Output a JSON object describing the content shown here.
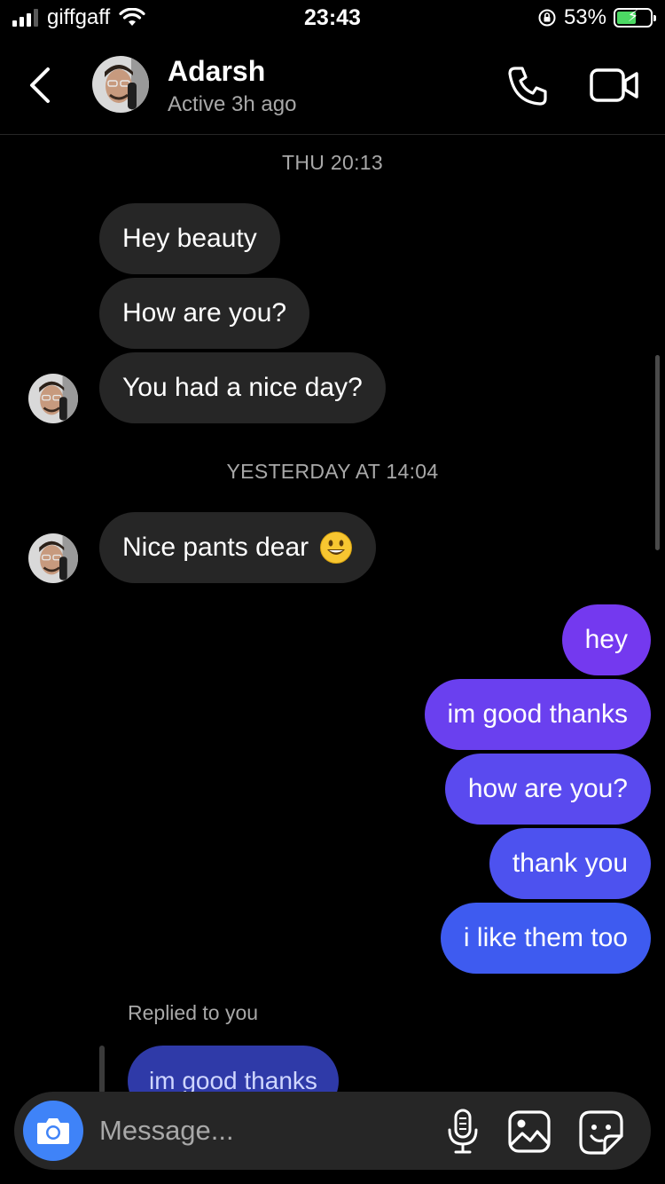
{
  "status_bar": {
    "carrier": "giffgaff",
    "time": "23:43",
    "battery_percent": "53%",
    "battery_level": 0.53,
    "icons": [
      "cellular-signal-icon",
      "wifi-icon",
      "orientation-lock-icon",
      "battery-charging-icon"
    ]
  },
  "header": {
    "name": "Adarsh",
    "status": "Active 3h ago",
    "icons": [
      "back-chevron-icon",
      "avatar",
      "phone-icon",
      "video-camera-icon"
    ]
  },
  "conversation": {
    "timestamp1": "THU 20:13",
    "incoming_group1": [
      "Hey beauty",
      "How are you?",
      "You had a nice day?"
    ],
    "timestamp2": "YESTERDAY AT 14:04",
    "incoming_group2": [
      "Nice pants dear"
    ],
    "outgoing": [
      "hey",
      "im good thanks",
      "how are you?",
      "thank you",
      "i like them too"
    ],
    "replied_label": "Replied to you",
    "reply_quote": "im good thanks"
  },
  "composer": {
    "placeholder": "Message...",
    "icons": [
      "camera-icon",
      "microphone-icon",
      "gallery-icon",
      "sticker-icon"
    ]
  },
  "colors": {
    "background": "#000000",
    "incoming_bubble": "#262626",
    "outgoing_top": "#7b3cf0",
    "outgoing_bottom": "#3d5bf0",
    "camera_button": "#3f83f8",
    "secondary_text": "#a8a8a8"
  }
}
